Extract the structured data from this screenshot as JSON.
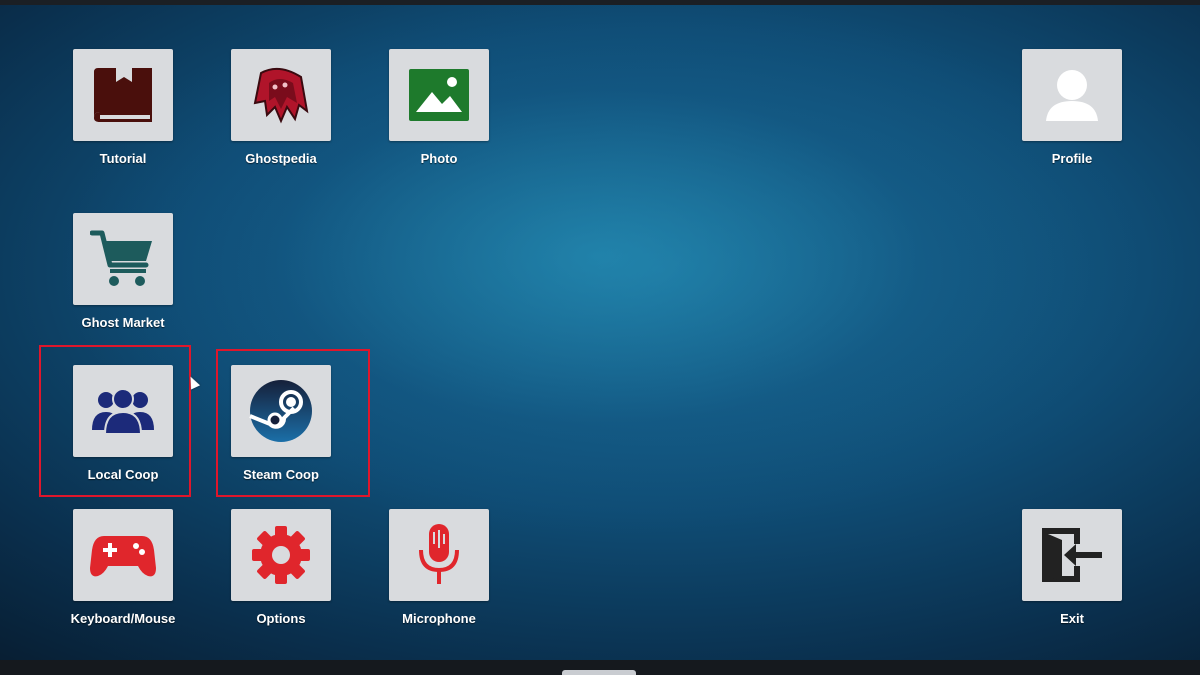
{
  "apps": {
    "tutorial": {
      "label": "Tutorial",
      "icon": "book-icon"
    },
    "ghostpedia": {
      "label": "Ghostpedia",
      "icon": "ghost-icon"
    },
    "photo": {
      "label": "Photo",
      "icon": "photo-icon"
    },
    "profile": {
      "label": "Profile",
      "icon": "user-icon"
    },
    "ghost_market": {
      "label": "Ghost Market",
      "icon": "shopping-cart-icon"
    },
    "local_coop": {
      "label": "Local Coop",
      "icon": "people-group-icon"
    },
    "steam_coop": {
      "label": "Steam Coop",
      "icon": "steam-icon"
    },
    "keyboard_mouse": {
      "label": "Keyboard/Mouse",
      "icon": "gamepad-icon"
    },
    "options": {
      "label": "Options",
      "icon": "gear-icon"
    },
    "microphone": {
      "label": "Microphone",
      "icon": "microphone-icon"
    },
    "exit": {
      "label": "Exit",
      "icon": "exit-icon"
    }
  },
  "colors": {
    "tile": "#d9dbde",
    "icon_red": "#e0262c",
    "icon_darkred": "#4a0f0c",
    "icon_green": "#1e7a2c",
    "icon_teal": "#1d5b5c",
    "icon_navy": "#1c2a7a",
    "highlight": "#e0162b"
  }
}
